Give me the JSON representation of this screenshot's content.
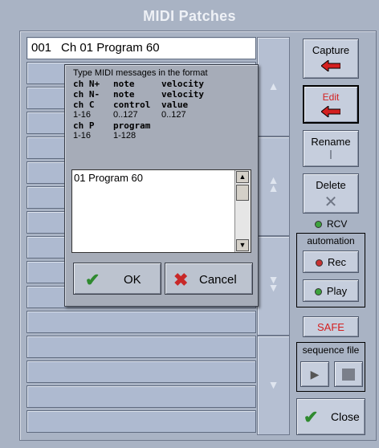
{
  "window": {
    "title": "MIDI Patches"
  },
  "patch_list": {
    "rows": [
      {
        "num": "001",
        "name": "Ch 01 Program 60",
        "selected": true
      },
      {
        "num": "",
        "name": ""
      },
      {
        "num": "",
        "name": ""
      },
      {
        "num": "",
        "name": ""
      },
      {
        "num": "",
        "name": ""
      },
      {
        "num": "",
        "name": ""
      },
      {
        "num": "",
        "name": ""
      },
      {
        "num": "",
        "name": ""
      },
      {
        "num": "",
        "name": ""
      },
      {
        "num": "",
        "name": ""
      },
      {
        "num": "",
        "name": ""
      },
      {
        "num": "",
        "name": ""
      },
      {
        "num": "",
        "name": ""
      },
      {
        "num": "",
        "name": ""
      },
      {
        "num": "",
        "name": ""
      },
      {
        "num": "",
        "name": ""
      }
    ]
  },
  "right_panel": {
    "capture_label": "Capture",
    "edit_label": "Edit",
    "rename_label": "Rename",
    "delete_label": "Delete",
    "rcv_label": "RCV",
    "automation_label": "automation",
    "rec_label": "Rec",
    "play_label": "Play",
    "safe_label": "SAFE",
    "sequence_file_label": "sequence file",
    "close_label": "Close"
  },
  "dialog": {
    "hint_title": "Type MIDI messages in the format",
    "hint_lines": [
      [
        "ch N+",
        "note",
        "velocity"
      ],
      [
        "ch N-",
        "note",
        "velocity"
      ],
      [
        "ch C",
        "control",
        "value"
      ],
      [
        "1-16",
        "0..127",
        "0..127"
      ],
      [
        "ch P",
        "program",
        ""
      ],
      [
        "1-16",
        "1-128",
        ""
      ]
    ],
    "text_value": "01 Program 60",
    "ok_label": "OK",
    "cancel_label": "Cancel"
  },
  "colors": {
    "background": "#a9b3c4",
    "accent_red": "#d42020",
    "check_green": "#2f8a2f"
  }
}
